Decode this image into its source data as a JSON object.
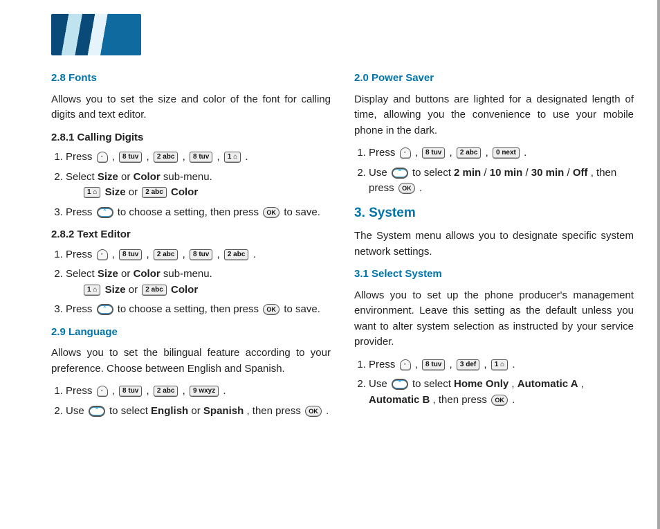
{
  "keys": {
    "menu": "",
    "ok": "OK",
    "nav": "",
    "k1": "1 ⌂",
    "k2": "2 abc",
    "k3": "3 def",
    "k8": "8 tuv",
    "k9": "9 wxyz",
    "k0": "0 next"
  },
  "left": {
    "s28": {
      "title": "2.8 Fonts",
      "desc": "Allows you to set the size and color of the font for calling digits and text editor.",
      "s281": {
        "title": "2.8.1 Calling Digits",
        "li1a": "Press ",
        "li1b": " , ",
        "li1c": " , ",
        "li1d": " , ",
        "li1e": " , ",
        "li1f": " .",
        "li2": "Select ",
        "li2b": "Size",
        "li2c": " or ",
        "li2d": "Color",
        "li2e": " sub-menu.",
        "li2row_a": " ",
        "li2row_size": "Size",
        "li2row_or": " or ",
        "li2row_color": "Color",
        "li3a": "Press ",
        "li3b": " to choose a setting, then press ",
        "li3c": " to save."
      },
      "s282": {
        "title": "2.8.2 Text Editor",
        "li1a": "Press ",
        "li1b": " , ",
        "li1c": " , ",
        "li1d": " , ",
        "li1e": " , ",
        "li1f": " .",
        "li2": "Select ",
        "li2b": "Size",
        "li2c": " or ",
        "li2d": "Color",
        "li2e": " sub-menu.",
        "li2row_size": "Size",
        "li2row_or": " or ",
        "li2row_color": "Color",
        "li3a": "Press ",
        "li3b": " to choose a setting, then press ",
        "li3c": " to save."
      }
    },
    "s29": {
      "title": "2.9 Language",
      "desc": "Allows you to set the bilingual feature according to your preference. Choose between English and Spanish.",
      "li1a": "Press ",
      "li1b": " , ",
      "li1c": " , ",
      "li1d": " , ",
      "li1e": " .",
      "li2a": "Use ",
      "li2b": " to select ",
      "li2c": "English",
      "li2d": " or ",
      "li2e": "Spanish",
      "li2f": ", then press ",
      "li2g": " ."
    }
  },
  "right": {
    "s20": {
      "title": "2.0 Power Saver",
      "desc": "Display and buttons are lighted for a designated length of time, allowing you the convenience to use your mobile phone in the dark.",
      "li1a": "Press ",
      "li1b": " , ",
      "li1c": " , ",
      "li1d": " , ",
      "li1e": " .",
      "li2a": "Use ",
      "li2b": " to select ",
      "li2c": "2 min",
      "li2d": " / ",
      "li2e": "10 min",
      "li2f": " / ",
      "li2g": "30 min",
      "li2h": " / ",
      "li2i": "Off",
      "li2j": ", then press ",
      "li2k": " ."
    },
    "s3": {
      "title": "3. System",
      "desc": "The System menu allows you to designate specific system network settings."
    },
    "s31": {
      "title": "3.1 Select System",
      "desc": "Allows you to set up the phone producer's management environment. Leave this setting as the default unless you want to alter system selection as instructed by your service provider.",
      "li1a": "Press ",
      "li1b": " , ",
      "li1c": " , ",
      "li1d": " , ",
      "li1e": " .",
      "li2a": "Use ",
      "li2b": " to select ",
      "li2c": "Home Only",
      "li2d": ", ",
      "li2e": "Automatic A",
      "li2f": ", ",
      "li2g": "Automatic B",
      "li2h": ", then press ",
      "li2i": " ."
    }
  }
}
